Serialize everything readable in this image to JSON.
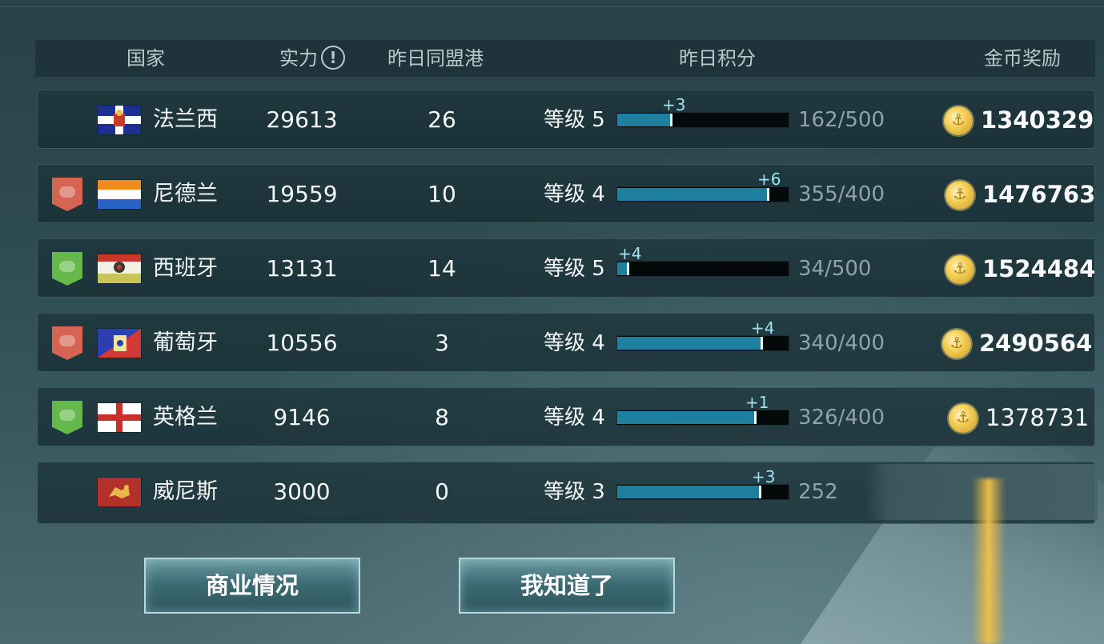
{
  "header": {
    "country": "国家",
    "power": "实力",
    "info_glyph": "!",
    "ports": "昨日同盟港",
    "score": "昨日积分",
    "gold": "金币奖励"
  },
  "rows": [
    {
      "country": "法兰西",
      "alliance": "none",
      "flag": "france-flag",
      "power": "29613",
      "ports": "26",
      "level": "等级 5",
      "progress_fraction": 0.324,
      "delta": "+3",
      "progress": "162/500",
      "gold": "1340329"
    },
    {
      "country": "尼德兰",
      "alliance": "red",
      "flag": "netherlands-flag",
      "power": "19559",
      "ports": "10",
      "level": "等级 4",
      "progress_fraction": 0.8875,
      "delta": "+6",
      "progress": "355/400",
      "gold": "1476763"
    },
    {
      "country": "西班牙",
      "alliance": "green",
      "flag": "spain-flag",
      "power": "13131",
      "ports": "14",
      "level": "等级 5",
      "progress_fraction": 0.068,
      "delta": "+4",
      "progress": "34/500",
      "gold": "1524484"
    },
    {
      "country": "葡萄牙",
      "alliance": "red",
      "flag": "portugal-flag",
      "power": "10556",
      "ports": "3",
      "level": "等级 4",
      "progress_fraction": 0.85,
      "delta": "+4",
      "progress": "340/400",
      "gold": "2490564"
    },
    {
      "country": "英格兰",
      "alliance": "green",
      "flag": "england-flag",
      "power": "9146",
      "ports": "8",
      "level": "等级 4",
      "progress_fraction": 0.815,
      "delta": "+1",
      "progress": "326/400",
      "gold": "1378731"
    },
    {
      "country": "威尼斯",
      "alliance": "none",
      "flag": "venice-flag",
      "power": "3000",
      "ports": "0",
      "level": "等级 3",
      "progress_fraction": 0.84,
      "delta": "+3",
      "progress": "252",
      "gold": ""
    }
  ],
  "buttons": {
    "commerce": "商业情况",
    "ok": "我知道了"
  },
  "colors": {
    "bar_fill": "#1e7f9f",
    "delta_text": "#9fe3f2",
    "alliance_red": "#d56452",
    "alliance_green": "#65b84a",
    "coin": "#f4cf54"
  }
}
